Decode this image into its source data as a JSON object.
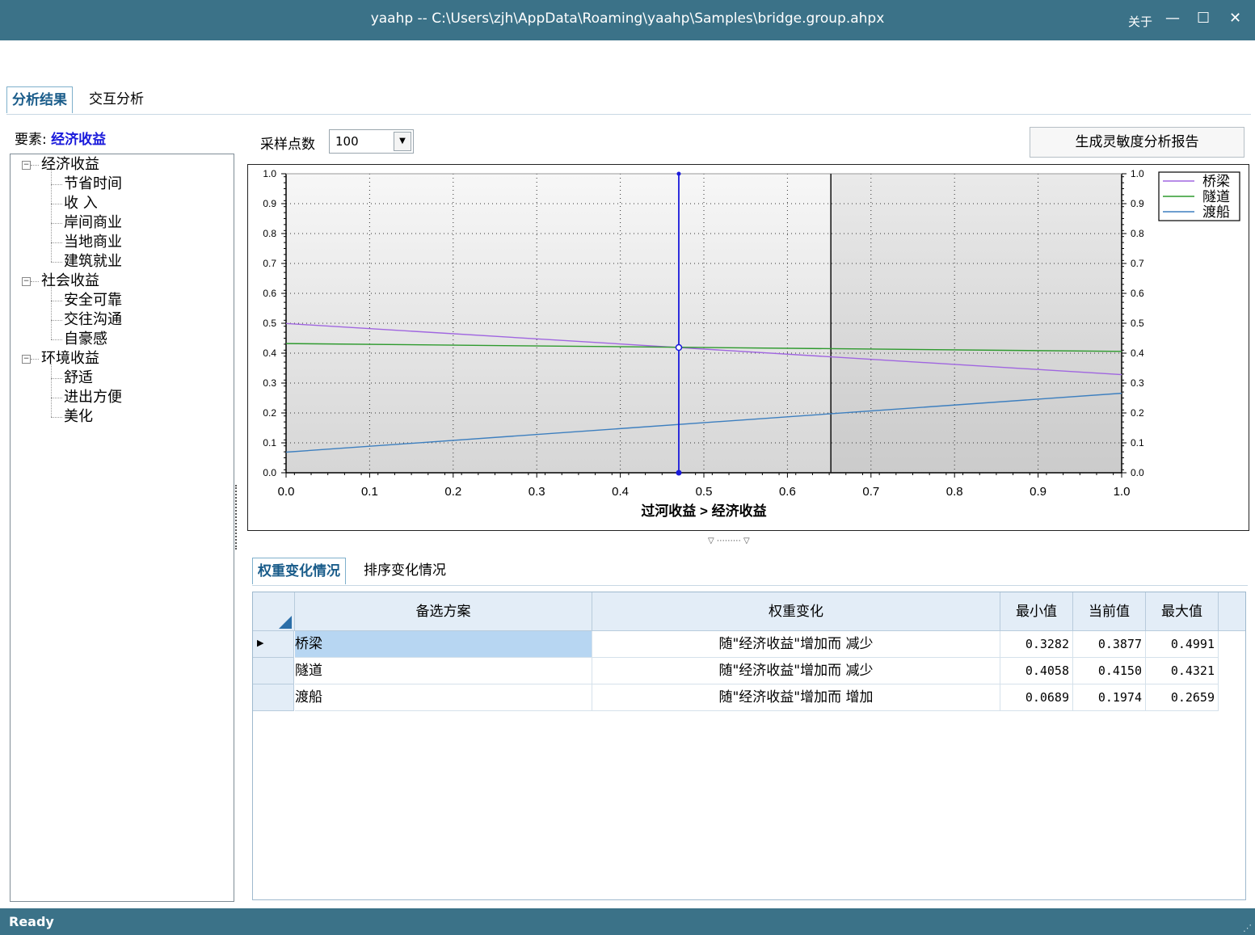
{
  "window": {
    "title": "yaahp -- C:\\Users\\zjh\\AppData\\Roaming\\yaahp\\Samples\\bridge.group.ahpx",
    "about": "关于",
    "minimize": "—",
    "maximize": "☐",
    "close": "✕"
  },
  "top_tabs": [
    {
      "label": "分析结果",
      "active": true
    },
    {
      "label": "交互分析",
      "active": false
    }
  ],
  "element": {
    "label": "要素:",
    "value": "经济收益"
  },
  "tree": [
    {
      "label": "经济收益",
      "level": 0
    },
    {
      "label": "节省时间",
      "level": 1
    },
    {
      "label": "收  入",
      "level": 1
    },
    {
      "label": "岸间商业",
      "level": 1
    },
    {
      "label": "当地商业",
      "level": 1
    },
    {
      "label": "建筑就业",
      "level": 1
    },
    {
      "label": "社会收益",
      "level": 0
    },
    {
      "label": "安全可靠",
      "level": 1
    },
    {
      "label": "交往沟通",
      "level": 1
    },
    {
      "label": "自豪感",
      "level": 1
    },
    {
      "label": "环境收益",
      "level": 0
    },
    {
      "label": "舒适",
      "level": 1
    },
    {
      "label": "进出方便",
      "level": 1
    },
    {
      "label": "美化",
      "level": 1
    }
  ],
  "toolbar": {
    "sample_label": "采样点数",
    "sample_value": "100",
    "report_button": "生成灵敏度分析报告"
  },
  "chart_data": {
    "type": "line",
    "xlabel": "过河收益 > 经济收益",
    "ylabel": "",
    "xlim": [
      0,
      1
    ],
    "ylim": [
      0,
      1
    ],
    "x_ticks": [
      "0.0",
      "0.1",
      "0.2",
      "0.3",
      "0.4",
      "0.5",
      "0.6",
      "0.7",
      "0.8",
      "0.9",
      "1.0"
    ],
    "y_ticks": [
      "0.0",
      "0.1",
      "0.2",
      "0.3",
      "0.4",
      "0.5",
      "0.6",
      "0.7",
      "0.8",
      "0.9",
      "1.0"
    ],
    "grid": true,
    "legend_position": "top-right",
    "current_weight": 0.47,
    "reference_weight": 0.652,
    "series": [
      {
        "name": "桥梁",
        "color": "#a066e0",
        "x": [
          0,
          1
        ],
        "y": [
          0.4991,
          0.3282
        ]
      },
      {
        "name": "隧道",
        "color": "#2e9a2e",
        "x": [
          0,
          1
        ],
        "y": [
          0.4321,
          0.4058
        ]
      },
      {
        "name": "渡船",
        "color": "#3d7fbf",
        "x": [
          0,
          1
        ],
        "y": [
          0.0689,
          0.2659
        ]
      }
    ]
  },
  "lower_tabs": [
    {
      "label": "权重变化情况",
      "active": true
    },
    {
      "label": "排序变化情况",
      "active": false
    }
  ],
  "table": {
    "headers": [
      "备选方案",
      "权重变化",
      "最小值",
      "当前值",
      "最大值"
    ],
    "rows": [
      {
        "name": "桥梁",
        "change": "随\"经济收益\"增加而 减少",
        "min": "0.3282",
        "cur": "0.3877",
        "max": "0.4991"
      },
      {
        "name": "隧道",
        "change": "随\"经济收益\"增加而 减少",
        "min": "0.4058",
        "cur": "0.4150",
        "max": "0.4321"
      },
      {
        "name": "渡船",
        "change": "随\"经济收益\"增加而 增加",
        "min": "0.0689",
        "cur": "0.1974",
        "max": "0.2659"
      }
    ]
  },
  "status": "Ready"
}
